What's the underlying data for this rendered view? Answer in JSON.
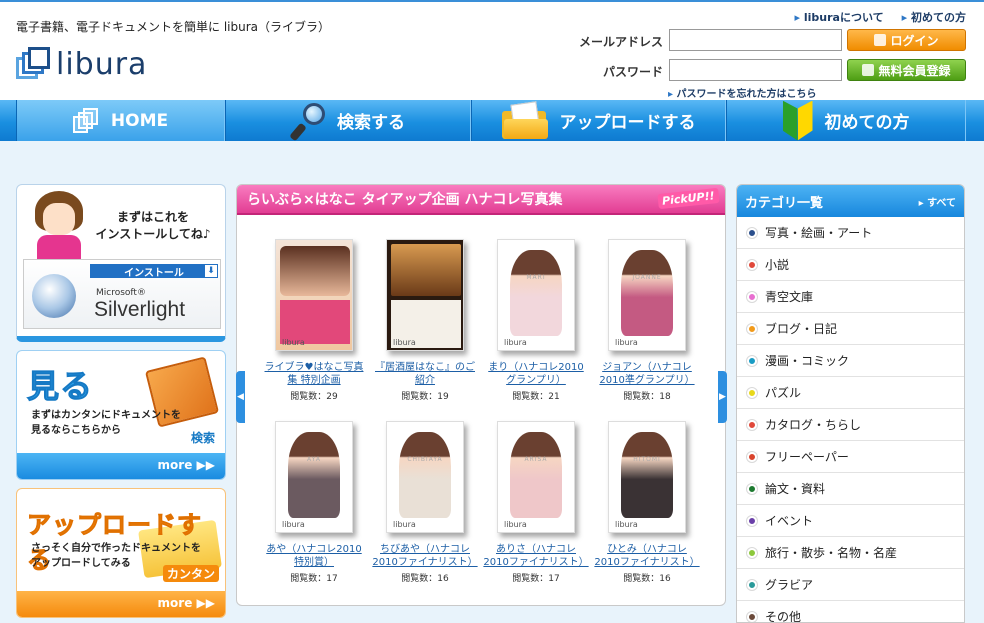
{
  "header": {
    "tagline": "電子書籍、電子ドキュメントを簡単に libura（ライブラ）",
    "logo_text": "libura",
    "links": [
      "liburaについて",
      "初めての方"
    ],
    "email_label": "メールアドレス",
    "password_label": "パスワード",
    "email_value": "",
    "password_value": "",
    "login_button": "ログイン",
    "register_button": "無料会員登録",
    "forgot_link": "パスワードを忘れた方はこちら"
  },
  "nav": {
    "items": [
      {
        "label": "HOME",
        "icon": "documents-icon",
        "active": true
      },
      {
        "label": "検索する",
        "icon": "magnifier-icon",
        "active": false
      },
      {
        "label": "アップロードする",
        "icon": "folder-icon",
        "active": false
      },
      {
        "label": "初めての方",
        "icon": "beginner-mark-icon",
        "active": false
      }
    ]
  },
  "left": {
    "install": {
      "message": [
        "まずはこれを",
        "インストールしてね♪"
      ],
      "install_label": "インストール",
      "ms_label": "Microsoft®",
      "product": "Silverlight"
    },
    "view": {
      "title": "見る",
      "desc": [
        "まずはカンタンにドキュメントを",
        "見るならこちらから"
      ],
      "tag": "検索",
      "more": "more ▶▶"
    },
    "upload": {
      "title": "アップロードする",
      "desc": [
        "さっそく自分で作ったドキュメントを",
        "アップロードしてみる"
      ],
      "tag": "カンタン",
      "more": "more ▶▶"
    }
  },
  "pickup": {
    "title": "らいぶら×はなこ タイアップ企画 ハナコレ写真集",
    "badge": "PickUP!!",
    "items": [
      {
        "caption": [
          "ライブラ♥はなこ写真",
          "集 特別企画"
        ],
        "views": "閲覧数：29",
        "name": "",
        "style": "poster1"
      },
      {
        "caption": [
          "『居酒屋はなこ』のご",
          "紹介"
        ],
        "views": "閲覧数：19",
        "name": "",
        "style": "poster2"
      },
      {
        "caption": [
          "まり（ハナコレ2010",
          "グランプリ）"
        ],
        "views": "閲覧数：21",
        "name": "MARI",
        "style": "photo",
        "color": "#f2d7dc"
      },
      {
        "caption": [
          "ジョアン（ハナコレ",
          "2010準グランプリ）"
        ],
        "views": "閲覧数：18",
        "name": "JOANNE",
        "style": "photo",
        "color": "#c45a82"
      },
      {
        "caption": [
          "あや（ハナコレ2010",
          "特別賞）"
        ],
        "views": "閲覧数：17",
        "name": "AYA",
        "style": "photo",
        "color": "#6b5a60"
      },
      {
        "caption": [
          "ちびあや（ハナコレ",
          "2010ファイナリスト）"
        ],
        "views": "閲覧数：16",
        "name": "CHIBIAYA",
        "style": "photo",
        "color": "#e9e0d6"
      },
      {
        "caption": [
          "ありさ（ハナコレ",
          "2010ファイナリスト）"
        ],
        "views": "閲覧数：17",
        "name": "ARISA",
        "style": "photo",
        "color": "#efc7c9"
      },
      {
        "caption": [
          "ひとみ（ハナコレ",
          "2010ファイナリスト）"
        ],
        "views": "閲覧数：16",
        "name": "HITOMI",
        "style": "photo",
        "color": "#3a3234"
      }
    ]
  },
  "category": {
    "title": "カテゴリ一覧",
    "all_link": "すべて",
    "items": [
      {
        "label": "写真・絵画・アート",
        "color": "#2b4f8c"
      },
      {
        "label": "小説",
        "color": "#e0483a"
      },
      {
        "label": "青空文庫",
        "color": "#e86fd0"
      },
      {
        "label": "ブログ・日記",
        "color": "#f29a1a"
      },
      {
        "label": "漫画・コミック",
        "color": "#1a9cc4"
      },
      {
        "label": "パズル",
        "color": "#e8d81a"
      },
      {
        "label": "カタログ・ちらし",
        "color": "#e0483a"
      },
      {
        "label": "フリーペーパー",
        "color": "#d9432c"
      },
      {
        "label": "論文・資料",
        "color": "#1d7a30"
      },
      {
        "label": "イベント",
        "color": "#6a3fa8"
      },
      {
        "label": "旅行・散歩・名物・名産",
        "color": "#8cc83c"
      },
      {
        "label": "グラビア",
        "color": "#2a9a9a"
      },
      {
        "label": "その他",
        "color": "#6b4a3a"
      }
    ]
  }
}
